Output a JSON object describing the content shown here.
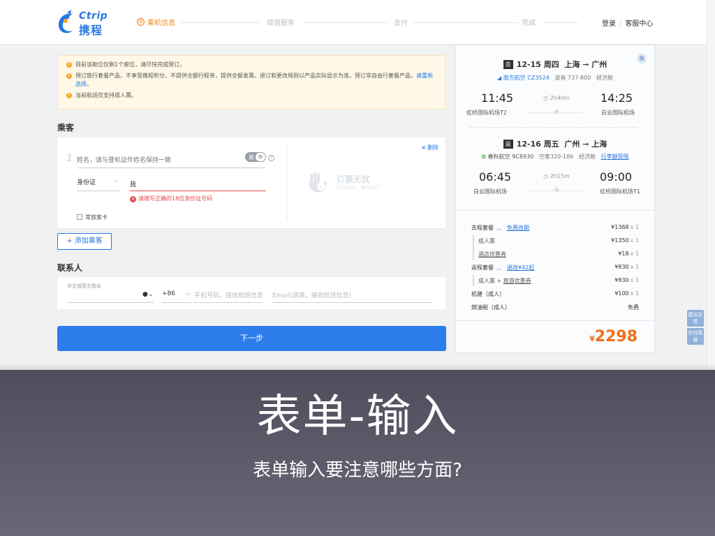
{
  "header": {
    "logo_en": "Ctrip",
    "logo_cn": "携程",
    "steps": [
      "乘机信息",
      "增值服务",
      "支付",
      "完成"
    ],
    "login": "登录",
    "service": "客服中心"
  },
  "notices": [
    "目前该舱位仅剩1个座位，请尽快完成预订。",
    "预订旅行套餐产品，不享受携程积分，不提供全额行程单，提供全额发票。退订和更改规则以产品实际显示为准。预订非自由行套餐产品，",
    "请重新选择",
    "。",
    "当前航班仅支持成人票。"
  ],
  "passenger": {
    "section_title": "乘客",
    "index": "1",
    "name_placeholder": "姓名，请与登机证件姓名保持一致",
    "lang_en": "英",
    "lang_cn": "中",
    "help": "?",
    "id_type": "身份证",
    "id_value": "我",
    "id_error": "请填写正确的18位身份证号码",
    "frequent": "常旅客卡",
    "delete": "删除",
    "watermark_title": "订票无忧",
    "watermark_sub": "价格保障，确保成行",
    "add_button": "+ 添加乘客"
  },
  "contact": {
    "section_title": "联系人",
    "name_label": "中文或英文姓名",
    "code": "+86",
    "phone_placeholder": "手机号码，接收航班信息",
    "email_placeholder": "Email(选填，接收航班信息)"
  },
  "next_button": "下一步",
  "trip": {
    "badge": "保",
    "outbound": {
      "tag": "去",
      "date": "12-15 周四",
      "route": "上海 ➞ 广州",
      "airline": "南方航空 CZ3524",
      "aircraft": "波音 737-800",
      "cabin": "经济舱",
      "dep_time": "11:45",
      "arr_time": "14:25",
      "duration": "2h40m",
      "dep_airport": "虹桥国际机场T2",
      "arr_airport": "白云国际机场"
    },
    "return": {
      "tag": "返",
      "date": "12-16 周五",
      "route": "广州 ➞ 上海",
      "airline": "春秋航空 9C8930",
      "aircraft": "空客320-186",
      "cabin": "经济舱",
      "rule": "行李额受限",
      "dep_time": "06:45",
      "arr_time": "09:00",
      "duration": "2h15m",
      "dep_airport": "白云国际机场",
      "arr_airport": "虹桥国际机场T1"
    }
  },
  "prices": {
    "out_pkg": "去程套餐",
    "out_pkg_link": "免费改期",
    "out_pkg_price": "¥1368",
    "adult": "成人票",
    "adult_price": "¥1350",
    "hotel": "酒店优惠券",
    "hotel_price": "¥18",
    "ret_pkg": "返程套餐",
    "ret_pkg_link": "退改¥42起",
    "ret_pkg_price": "¥830",
    "ret_sub_prefix": "成人票 + ",
    "ret_sub_link": "旅游优惠券",
    "ret_sub_price": "¥830",
    "fee": "机建（成人）",
    "fee_price": "¥100",
    "fuel": "燃油税（成人）",
    "fuel_price": "免费",
    "mul": "x 1",
    "currency": "¥",
    "total": "2298"
  },
  "float": {
    "feedback": "建议反馈",
    "online": "在线客服"
  },
  "slide": {
    "title": "表单-输入",
    "subtitle": "表单输入要注意哪些方面?"
  }
}
